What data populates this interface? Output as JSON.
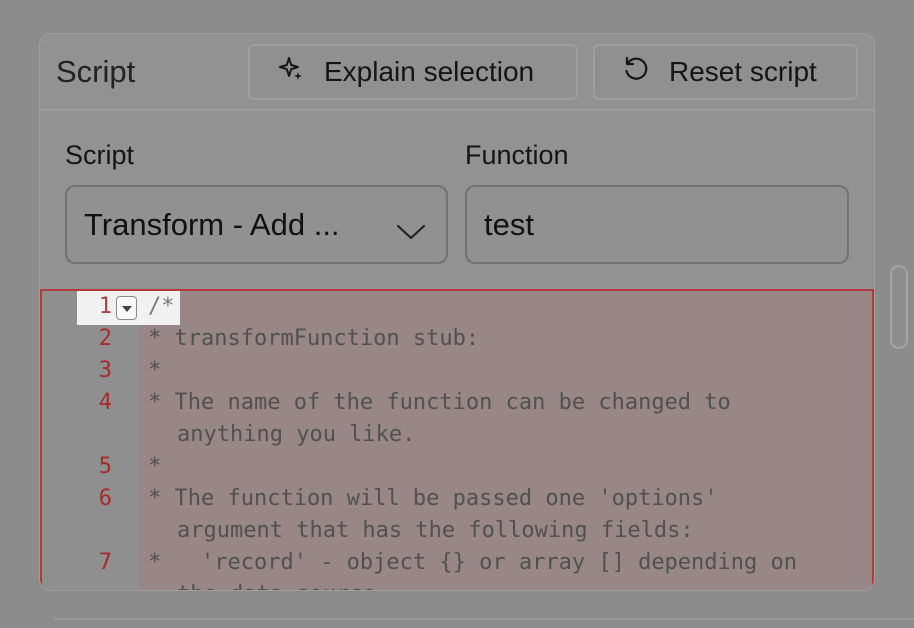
{
  "panel": {
    "title": "Script",
    "explain_button": "Explain selection",
    "reset_button": "Reset script"
  },
  "form": {
    "script_label": "Script",
    "script_value": "Transform - Add ...",
    "function_label": "Function",
    "function_value": "test"
  },
  "editor": {
    "lines": [
      {
        "n": "1",
        "text": "/*"
      },
      {
        "n": "2",
        "text": "* transformFunction stub:"
      },
      {
        "n": "3",
        "text": "*"
      },
      {
        "n": "4",
        "text": "* The name of the function can be changed to",
        "cont": "anything you like."
      },
      {
        "n": "5",
        "text": "*"
      },
      {
        "n": "6",
        "text": "* The function will be passed one 'options'",
        "cont": "argument that has the following fields:"
      },
      {
        "n": "7",
        "text": "*   'record' - object {} or array [] depending on",
        "cont": "the data source"
      }
    ]
  },
  "icons": {
    "explain": "sparkle-icon",
    "reset": "undo-icon",
    "select": "chevron-down-icon",
    "fold": "fold-arrow-icon"
  }
}
